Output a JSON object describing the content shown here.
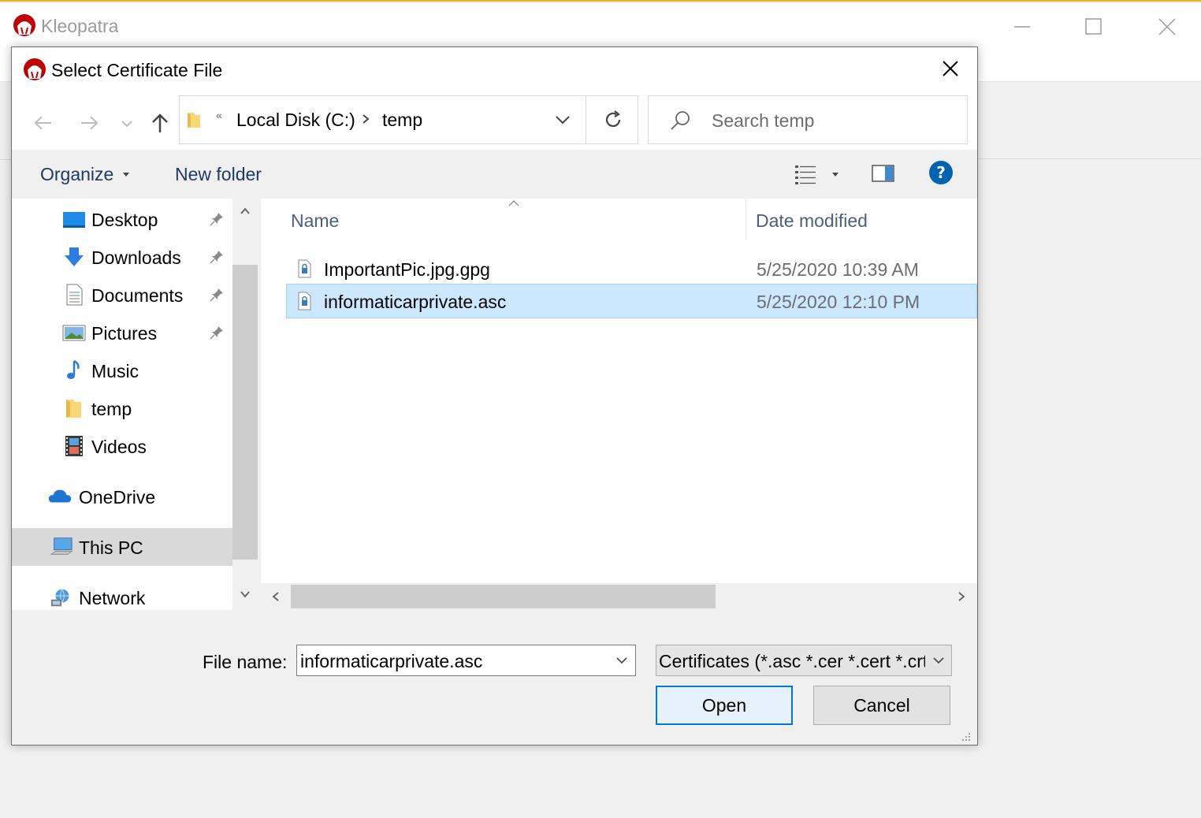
{
  "background_window": {
    "title": "Kleopatra",
    "controls": {
      "minimize": "minimize-icon",
      "maximize": "maximize-icon",
      "close": "close-icon"
    }
  },
  "dialog": {
    "title": "Select Certificate File",
    "address": {
      "overflow": "«",
      "crumbs": [
        "Local Disk (C:)",
        "temp"
      ]
    },
    "search": {
      "placeholder": "Search temp"
    },
    "commands": {
      "organize": "Organize",
      "new_folder": "New folder"
    },
    "nav_pane": {
      "items": [
        {
          "label": "Desktop",
          "icon": "desktop-icon",
          "pinned": true
        },
        {
          "label": "Downloads",
          "icon": "downloads-icon",
          "pinned": true
        },
        {
          "label": "Documents",
          "icon": "documents-icon",
          "pinned": true
        },
        {
          "label": "Pictures",
          "icon": "pictures-icon",
          "pinned": true
        },
        {
          "label": "Music",
          "icon": "music-icon",
          "pinned": false
        },
        {
          "label": "temp",
          "icon": "folder-icon",
          "pinned": false
        },
        {
          "label": "Videos",
          "icon": "videos-icon",
          "pinned": false
        },
        {
          "label": "OneDrive",
          "icon": "onedrive-icon",
          "pinned": false
        },
        {
          "label": "This PC",
          "icon": "this-pc-icon",
          "pinned": false,
          "selected": true
        },
        {
          "label": "Network",
          "icon": "network-icon",
          "pinned": false
        }
      ]
    },
    "file_list": {
      "columns": {
        "name": "Name",
        "date": "Date modified"
      },
      "rows": [
        {
          "name": "ImportantPic.jpg.gpg",
          "date": "5/25/2020 10:39 AM",
          "selected": false
        },
        {
          "name": "informaticarprivate.asc",
          "date": "5/25/2020 12:10 PM",
          "selected": true
        }
      ]
    },
    "file_name": {
      "label": "File name:",
      "value": "informaticarprivate.asc"
    },
    "filter": {
      "value": "Certificates (*.asc *.cer *.cert *.crt"
    },
    "buttons": {
      "open": "Open",
      "cancel": "Cancel"
    },
    "colors": {
      "accent": "#0078d7",
      "selection": "#cce8ff",
      "selection_border": "#99d1ff",
      "link_text": "#1e3a64",
      "help": "#0063b1"
    }
  }
}
